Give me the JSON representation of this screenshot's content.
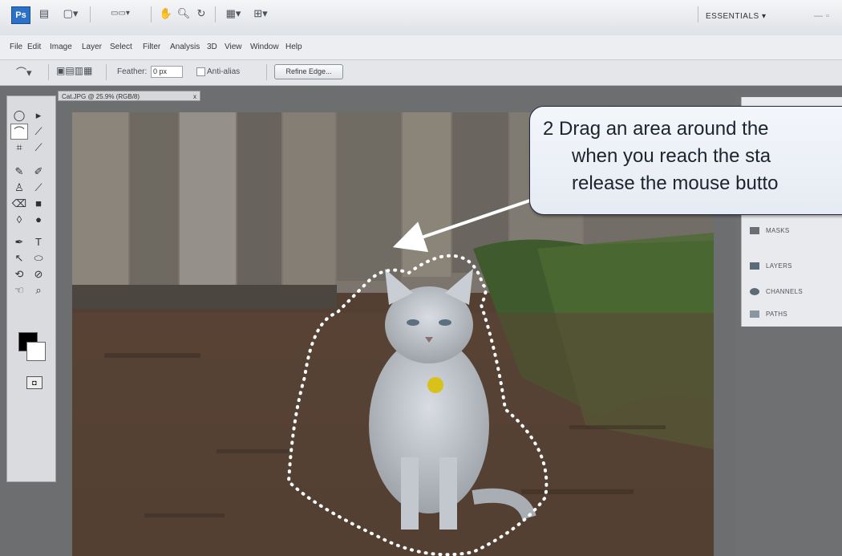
{
  "app": {
    "logo": "Ps",
    "workspace": "ESSENTIALS",
    "toolbar_icons": [
      "doc-icon",
      "screen-mode-icon",
      "zoom-level-icon",
      "hand-icon",
      "zoom-icon",
      "rotate-icon",
      "arrange-icon",
      "extras-icon"
    ]
  },
  "menu": [
    "File",
    "Edit",
    "Image",
    "Layer",
    "Select",
    "Filter",
    "Analysis",
    "3D",
    "View",
    "Window",
    "Help"
  ],
  "options": {
    "feather_label": "Feather:",
    "feather_value": "0 px",
    "antialias_label": "Anti-alias",
    "refine_label": "Refine Edge..."
  },
  "document": {
    "tab_title": "Cat.JPG @ 25.9% (RGB/8)",
    "close": "x"
  },
  "panels": [
    {
      "label": "MASKS"
    },
    {
      "label": "LAYERS"
    },
    {
      "label": "CHANNELS"
    },
    {
      "label": "PATHS"
    }
  ],
  "callout": {
    "line1": "2  Drag an area around the",
    "line2": "when you reach the sta",
    "line3": "release the mouse butto"
  },
  "colors": {
    "fg": "#000000",
    "bg": "#ffffff",
    "accent": "#2a71c7"
  }
}
